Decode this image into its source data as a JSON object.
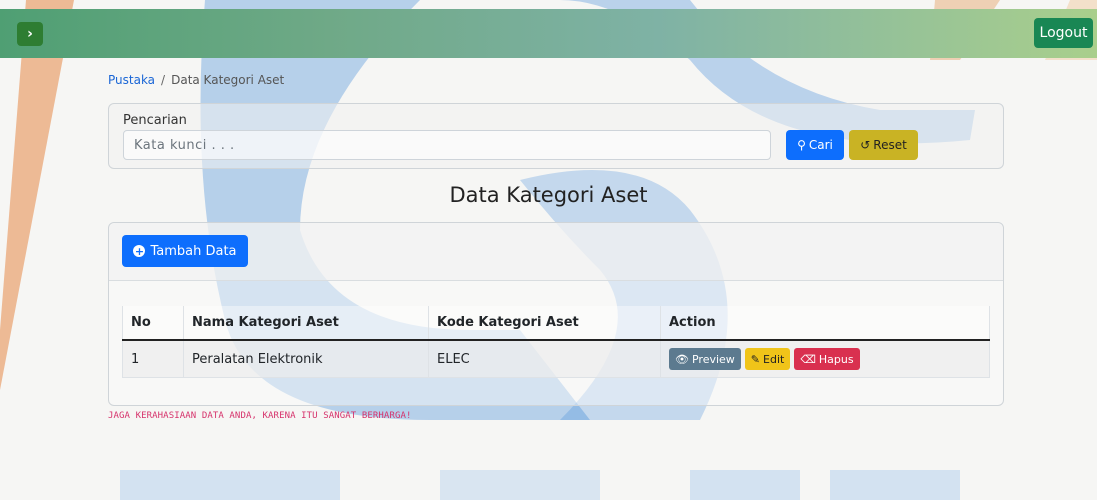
{
  "header": {
    "toggle_icon": "chevron-right-icon",
    "logout_label": "Logout"
  },
  "breadcrumb": {
    "root": "Pustaka",
    "separator": "/",
    "current": "Data Kategori Aset"
  },
  "search": {
    "label": "Pencarian",
    "value": "",
    "placeholder": "Kata kunci . . .",
    "search_button": "Cari",
    "reset_button": "Reset"
  },
  "page_title": "Data Kategori Aset",
  "card": {
    "add_button": "Tambah Data"
  },
  "table": {
    "columns": [
      "No",
      "Nama Kategori Aset",
      "Kode Kategori Aset",
      "Action"
    ],
    "rows": [
      {
        "no": "1",
        "nama": "Peralatan Elektronik",
        "kode": "ELEC",
        "actions": {
          "preview": "Preview",
          "edit": "Edit",
          "hapus": "Hapus"
        }
      }
    ]
  },
  "footer_note": "JAGA KERAHASIAAN DATA ANDA, KARENA ITU SANGAT BERHARGA!",
  "colors": {
    "primary": "#0d6efd",
    "success": "#198754",
    "warning": "#f0c419",
    "danger": "#d9304f",
    "secondary": "#5c7a8f",
    "watermark_blue": "#1e6fc9",
    "watermark_orange": "#e07b3d"
  }
}
